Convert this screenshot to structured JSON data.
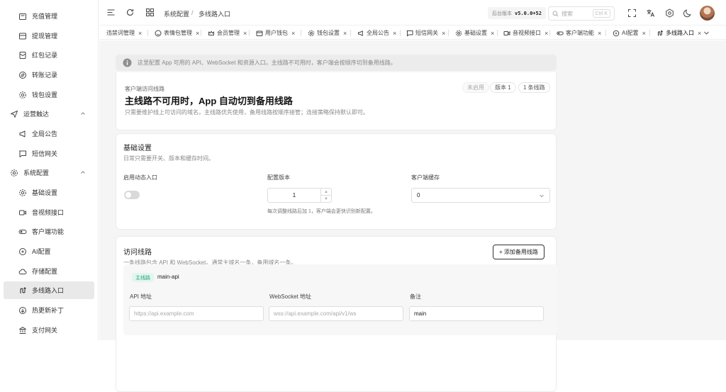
{
  "sidebar": {
    "items": [
      {
        "label": "充值管理",
        "icon": "wallet-icon"
      },
      {
        "label": "提现管理",
        "icon": "withdraw-icon"
      },
      {
        "label": "红包记录",
        "icon": "red-packet-icon"
      },
      {
        "label": "转账记录",
        "icon": "transfer-icon"
      },
      {
        "label": "钱包设置",
        "icon": "gear-icon"
      },
      {
        "label": "运营触达",
        "icon": "send-icon"
      },
      {
        "label": "全局公告",
        "icon": "megaphone-icon"
      },
      {
        "label": "短信网关",
        "icon": "message-icon"
      },
      {
        "label": "系统配置",
        "icon": "gear-icon"
      },
      {
        "label": "基础设置",
        "icon": "gear-icon"
      },
      {
        "label": "音视频接口",
        "icon": "video-icon"
      },
      {
        "label": "客户端功能",
        "icon": "toggle-icon"
      },
      {
        "label": "AI配置",
        "icon": "ai-icon"
      },
      {
        "label": "存储配置",
        "icon": "cloud-icon"
      },
      {
        "label": "多线路入口",
        "icon": "route-icon"
      },
      {
        "label": "热更新补丁",
        "icon": "patch-icon"
      },
      {
        "label": "支付网关",
        "icon": "bank-icon"
      }
    ]
  },
  "header": {
    "breadcrumb_parent": "系统配置",
    "breadcrumb_sep": "/",
    "breadcrumb_current": "多线路入口",
    "version_label": "后台版本",
    "version_value": "v5.0.0+52",
    "search_placeholder": "搜索",
    "search_shortcut": "Ctrl K"
  },
  "tabs": [
    {
      "label": "违禁词管理"
    },
    {
      "label": "表情包管理"
    },
    {
      "label": "会员管理"
    },
    {
      "label": "用户钱包"
    },
    {
      "label": "钱包设置"
    },
    {
      "label": "全局公告"
    },
    {
      "label": "短信网关"
    },
    {
      "label": "基础设置"
    },
    {
      "label": "音视频接口"
    },
    {
      "label": "客户端功能"
    },
    {
      "label": "AI配置"
    },
    {
      "label": "多线路入口"
    }
  ],
  "tab_close": "×",
  "notice": "这里配置 App 可用的 API、WebSocket 和资源入口。主线路不可用时，客户端会按顺序切到备用线路。",
  "hero": {
    "eyebrow": "客户端访问线路",
    "title": "主线路不可用时，App 自动切到备用线路",
    "desc": "只需要维护线上可访问的域名。主线路优先使用，备用线路按顺序接管；连接策略保持默认即可。",
    "status_pill": "未启用",
    "version_pill": "版本 1",
    "count_pill": "1 条线路"
  },
  "basic": {
    "title": "基础设置",
    "desc": "日常只需要开关、版本和缓存时间。",
    "enable_label": "启用动态入口",
    "enable_on": false,
    "version_label": "配置版本",
    "version_value": "1",
    "version_help": "每次调整线路后加 1，客户端会更快识别新配置。",
    "cache_label": "客户端缓存",
    "cache_value": "0"
  },
  "routes": {
    "title": "访问线路",
    "desc": "一条线路包含 API 和 WebSocket。通常主域名一条，备用域名一条。",
    "add_label": "+ 添加备用线路",
    "items": [
      {
        "tag": "主线路",
        "name": "main-api",
        "api_label": "API 地址",
        "api_placeholder": "https://api.example.com",
        "ws_label": "WebSocket 地址",
        "ws_placeholder": "wss://api.example.com/api/v1/ws",
        "note_label": "备注",
        "note_value": "main"
      }
    ]
  },
  "colors": {
    "accent_green": "#22a36e",
    "sidebar_active": "#e9e9e9",
    "content_bg": "#f5f5f5"
  }
}
